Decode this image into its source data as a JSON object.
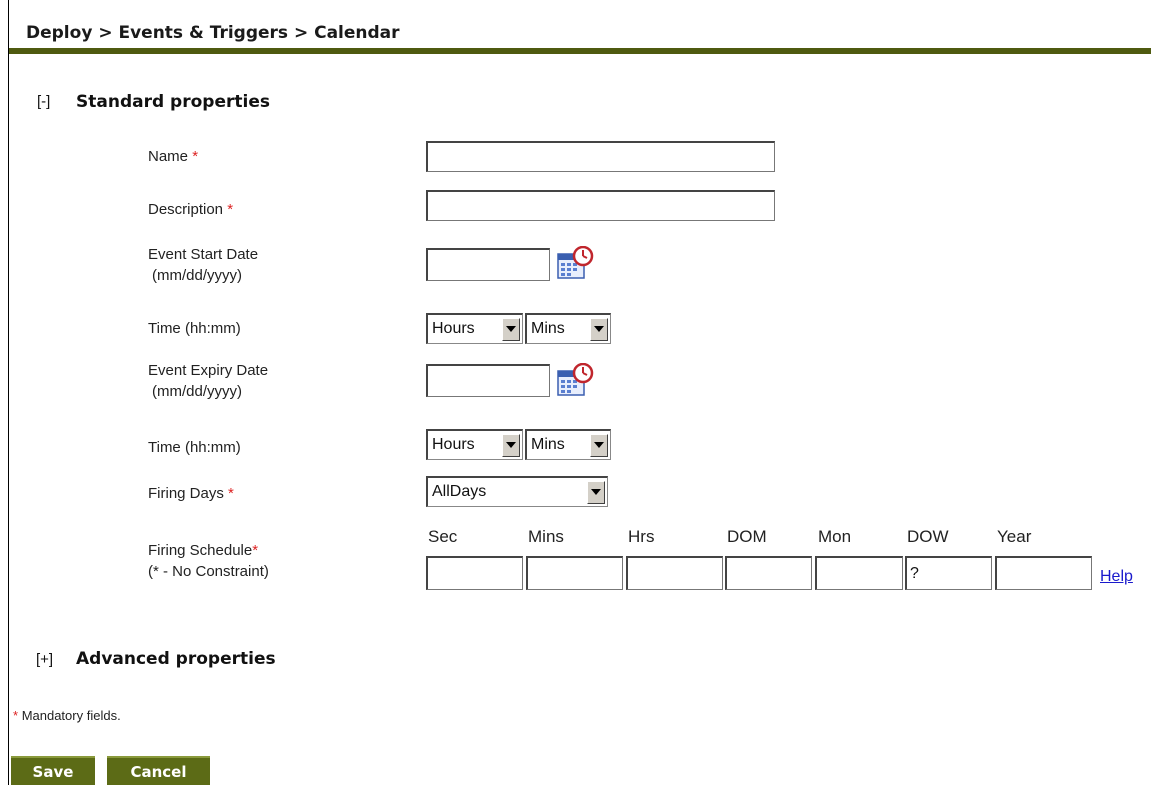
{
  "breadcrumb": "Deploy > Events & Triggers > Calendar",
  "sections": {
    "standard": {
      "toggle": "[-]",
      "title": "Standard properties"
    },
    "advanced": {
      "toggle": "[+]",
      "title": "Advanced properties"
    }
  },
  "required_marker": "*",
  "fields": {
    "name": {
      "label": "Name",
      "value": ""
    },
    "description": {
      "label": "Description",
      "value": ""
    },
    "start_date": {
      "label_line1": "Event Start Date",
      "label_line2": "(mm/dd/yyyy)",
      "value": ""
    },
    "start_time": {
      "label": "Time (hh:mm)",
      "hours": "Hours",
      "mins": "Mins"
    },
    "expiry_date": {
      "label_line1": "Event Expiry Date",
      "label_line2": "(mm/dd/yyyy)",
      "value": ""
    },
    "expiry_time": {
      "label": "Time (hh:mm)",
      "hours": "Hours",
      "mins": "Mins"
    },
    "firing_days": {
      "label": "Firing Days",
      "value": "AllDays"
    },
    "firing_schedule": {
      "label_line1": "Firing Schedule",
      "label_line2": "(* - No Constraint)",
      "columns": [
        "Sec",
        "Mins",
        "Hrs",
        "DOM",
        "Mon",
        "DOW",
        "Year"
      ],
      "values": [
        "",
        "",
        "",
        "",
        "",
        "?",
        ""
      ],
      "help": "Help"
    }
  },
  "footnote": {
    "marker": "*",
    "text": "Mandatory fields."
  },
  "buttons": {
    "save": "Save",
    "cancel": "Cancel"
  },
  "icons": {
    "calendar": "calendar-clock-icon"
  },
  "colors": {
    "accent_bar": "#4f5a10",
    "button": "#5c6b16",
    "required": "#dd2222",
    "link": "#1a1acc"
  }
}
